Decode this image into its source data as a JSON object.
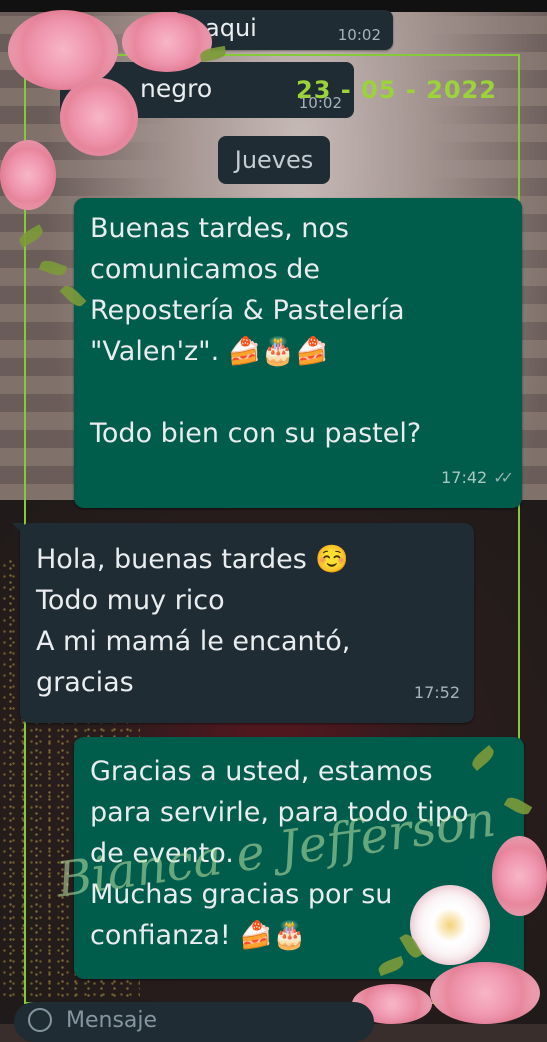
{
  "prev_messages": [
    {
      "text": "aqui",
      "time": "10:02"
    },
    {
      "text": "negro",
      "time": "10:02"
    }
  ],
  "date_decoration": "23 - 05 - 2022",
  "day_label": "Jueves",
  "messages": [
    {
      "direction": "outgoing",
      "lines": [
        "Buenas tardes, nos",
        "comunicamos de",
        "Repostería & Pastelería",
        "\"Valen'z\". 🍰🎂🍰",
        "",
        "Todo bien con su pastel?"
      ],
      "time": "17:42",
      "status": "read-double-check"
    },
    {
      "direction": "incoming",
      "lines": [
        "Hola, buenas tardes ☺️",
        "Todo muy rico",
        "A mi mamá le encantó,",
        "gracias"
      ],
      "time": "17:52"
    },
    {
      "direction": "outgoing",
      "lines": [
        "Gracias a usted, estamos",
        "para servirle, para todo tipo",
        "de evento.",
        "Muchas gracias por su",
        "confianza! 🍰🎂"
      ]
    }
  ],
  "watermark": "Bianca e Jefferson",
  "input": {
    "placeholder": "Mensaje"
  },
  "colors": {
    "outgoing_bubble": "#005c4b",
    "incoming_bubble": "#1f2c33",
    "frame": "#86c93a",
    "text": "#e9edef"
  }
}
